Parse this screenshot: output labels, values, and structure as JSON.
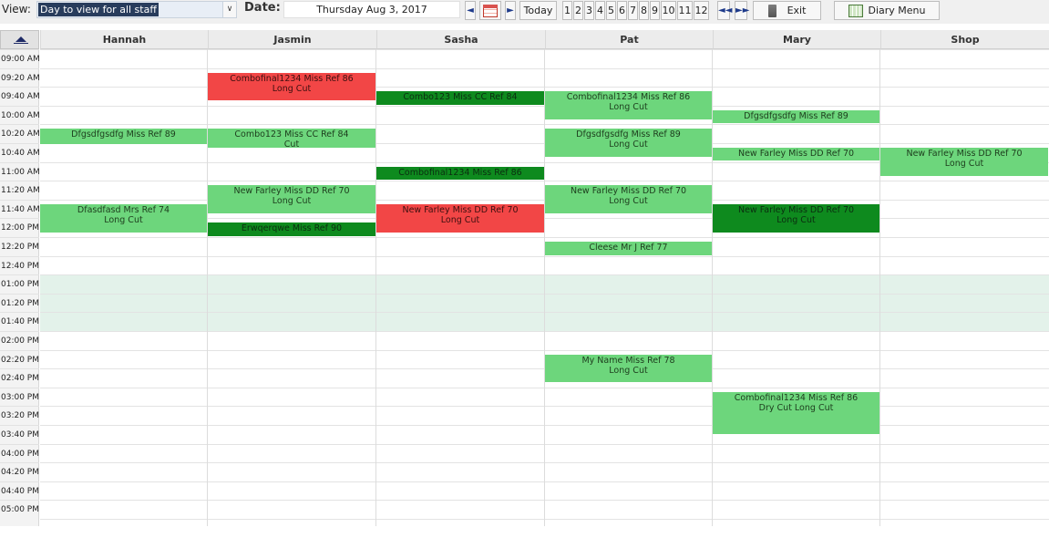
{
  "toolbar": {
    "view_label": "View:",
    "view_value": "Day to view for all staff",
    "date_label": "Date:",
    "date_value": "Thursday Aug 3, 2017",
    "prev_glyph": "◄",
    "next_glyph": "►",
    "calendar_icon": "calendar-icon",
    "today_label": "Today",
    "day_numbers": [
      "1",
      "2",
      "3",
      "4",
      "5",
      "6",
      "7",
      "8",
      "9",
      "10",
      "11",
      "12"
    ],
    "rewind_glyph": "◄◄",
    "forward_glyph": "►►",
    "exit_label": "Exit",
    "diary_label": "Diary Menu"
  },
  "columns": [
    "Hannah",
    "Jasmin",
    "Sasha",
    "Pat",
    "Mary",
    "Shop"
  ],
  "times": [
    "09:00 AM",
    "09:20 AM",
    "09:40 AM",
    "10:00 AM",
    "10:20 AM",
    "10:40 AM",
    "11:00 AM",
    "11:20 AM",
    "11:40 AM",
    "12:00 PM",
    "12:20 PM",
    "12:40 PM",
    "01:00 PM",
    "01:20 PM",
    "01:40 PM",
    "02:00 PM",
    "02:20 PM",
    "02:40 PM",
    "03:00 PM",
    "03:20 PM",
    "03:40 PM",
    "04:00 PM",
    "04:20 PM",
    "04:40 PM",
    "05:00 PM"
  ],
  "lunch_rows": [
    12,
    13,
    14
  ],
  "colors": {
    "light_green": "#6dd67c",
    "dark_green": "#0e8a1e",
    "red": "#f24646",
    "lunch": "#e3f2ea"
  },
  "appointments": [
    {
      "col": 1,
      "start": 1,
      "len": 1.5,
      "color": "red",
      "line1": "Combofinal1234  Miss   Ref 86",
      "line2": "Long Cut"
    },
    {
      "col": 1,
      "start": 4,
      "len": 1,
      "color": "light_green",
      "line1": "Combo123  Miss  CC Ref 84",
      "line2": "Cut"
    },
    {
      "col": 1,
      "start": 7,
      "len": 1.5,
      "color": "light_green",
      "line1": "New Farley  Miss  DD Ref 70",
      "line2": "Long Cut"
    },
    {
      "col": 1,
      "start": 9,
      "len": 0.7,
      "color": "dark_green",
      "line1": "Erwqerqwe  Miss   Ref 90",
      "line2": ""
    },
    {
      "col": 0,
      "start": 4,
      "len": 0.8,
      "color": "light_green",
      "line1": "Dfgsdfgsdfg   Miss    Ref 89",
      "line2": ""
    },
    {
      "col": 0,
      "start": 8,
      "len": 1.5,
      "color": "light_green",
      "line1": "Dfasdfasd  Mrs   Ref 74",
      "line2": "Long Cut"
    },
    {
      "col": 2,
      "start": 2,
      "len": 0.7,
      "color": "dark_green",
      "line1": "Combo123  Miss  CC Ref 84",
      "line2": ""
    },
    {
      "col": 2,
      "start": 6,
      "len": 0.7,
      "color": "dark_green",
      "line1": "Combofinal1234  Miss   Ref 86",
      "line2": ""
    },
    {
      "col": 2,
      "start": 8,
      "len": 1.5,
      "color": "red",
      "line1": "New Farley  Miss  DD Ref 70",
      "line2": "Long Cut"
    },
    {
      "col": 3,
      "start": 2,
      "len": 1.5,
      "color": "light_green",
      "line1": "Combofinal1234  Miss   Ref 86",
      "line2": "Long Cut"
    },
    {
      "col": 3,
      "start": 4,
      "len": 1.5,
      "color": "light_green",
      "line1": "Dfgsdfgsdfg  Miss   Ref 89",
      "line2": "Long Cut"
    },
    {
      "col": 3,
      "start": 7,
      "len": 1.5,
      "color": "light_green",
      "line1": "New Farley  Miss  DD Ref 70",
      "line2": "Long Cut"
    },
    {
      "col": 3,
      "start": 10,
      "len": 0.75,
      "color": "light_green",
      "line1": "Cleese  Mr  J Ref 77",
      "line2": ""
    },
    {
      "col": 3,
      "start": 16,
      "len": 1.5,
      "color": "light_green",
      "line1": "My Name  Miss   Ref 78",
      "line2": "Long Cut"
    },
    {
      "col": 4,
      "start": 3,
      "len": 0.7,
      "color": "light_green",
      "line1": "Dfgsdfgsdfg  Miss   Ref 89",
      "line2": ""
    },
    {
      "col": 4,
      "start": 5,
      "len": 0.7,
      "color": "light_green",
      "line1": "New Farley  Miss  DD Ref 70",
      "line2": ""
    },
    {
      "col": 4,
      "start": 8,
      "len": 1.5,
      "color": "dark_green",
      "line1": "New Farley  Miss  DD Ref 70",
      "line2": "Long Cut"
    },
    {
      "col": 4,
      "start": 18,
      "len": 2.25,
      "color": "light_green",
      "line1": "Combofinal1234  Miss   Ref 86",
      "line2": "Dry Cut Long Cut"
    },
    {
      "col": 5,
      "start": 5,
      "len": 1.5,
      "color": "light_green",
      "line1": "New Farley  Miss  DD Ref 70",
      "line2": "Long Cut"
    }
  ]
}
